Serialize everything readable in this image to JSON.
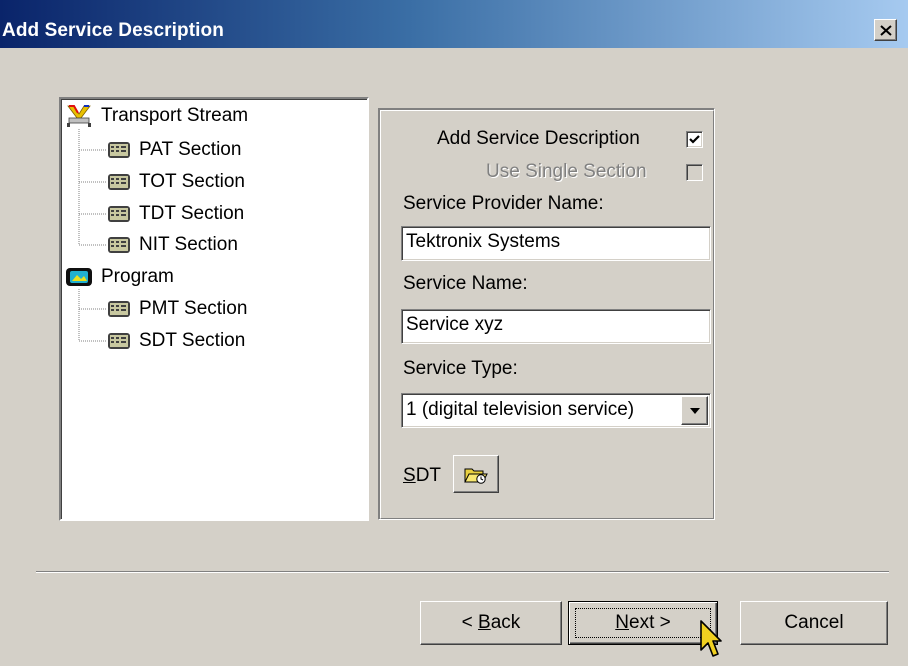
{
  "window": {
    "title": "Add Service Description",
    "close_glyph": "×"
  },
  "tree": {
    "root_transport": "Transport Stream",
    "transport_children": [
      "PAT Section",
      "TOT Section",
      "TDT Section",
      "NIT Section"
    ],
    "root_program": "Program",
    "program_children": [
      "PMT Section",
      "SDT Section"
    ]
  },
  "form": {
    "add_service_description_label": "Add Service Description",
    "add_service_description_checked": true,
    "use_single_section_label": "Use Single Section",
    "use_single_section_checked": false,
    "service_provider_name_label": "Service Provider Name:",
    "service_provider_name_value": "Tektronix Systems",
    "service_name_label": "Service Name:",
    "service_name_value": "Service xyz",
    "service_type_label": "Service Type:",
    "service_type_value": "1 (digital television service)",
    "sdt_label_first": "S",
    "sdt_label_rest": "DT"
  },
  "buttons": {
    "back_prefix": "< ",
    "back_accel": "B",
    "back_rest": "ack",
    "next_accel": "N",
    "next_rest": "ext >",
    "cancel": "Cancel"
  }
}
